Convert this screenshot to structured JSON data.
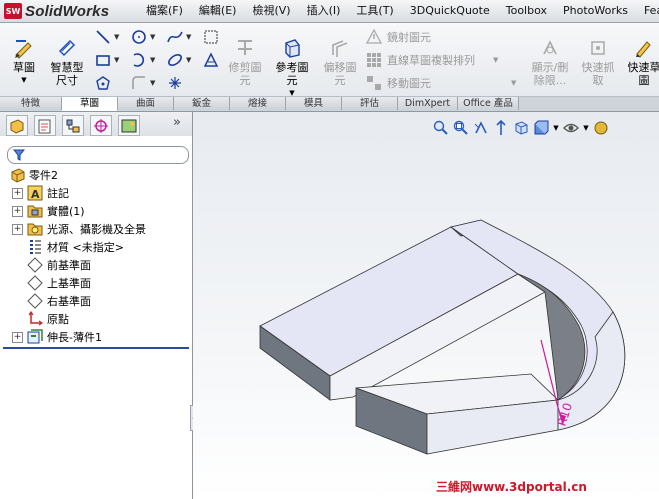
{
  "app": {
    "logo_badge": "SW",
    "name": "SolidWorks"
  },
  "menu": [
    "檔案(F)",
    "編輯(E)",
    "檢視(V)",
    "插入(I)",
    "工具(T)",
    "3DQuickQuote",
    "Toolbox",
    "PhotoWorks",
    "Featur"
  ],
  "ribbon": {
    "sketch": "草圖",
    "smart_dimension": [
      "智慧型",
      "尺寸"
    ],
    "trim": [
      "修剪圖",
      "元"
    ],
    "convert": [
      "參考圖",
      "元"
    ],
    "offset": [
      "偏移圖",
      "元"
    ],
    "mirror": "鏡射圖元",
    "linear_pattern": "直線草圖複製排列",
    "move": "移動圖元",
    "display_delete": [
      "顯示/刪",
      "除限..."
    ],
    "quick_snaps": [
      "快速抓",
      "取"
    ],
    "rapid_sketch": [
      "快速草",
      "圖"
    ]
  },
  "tabs": [
    "特徵",
    "草圖",
    "曲面",
    "鈑金",
    "熔接",
    "模具",
    "評估",
    "DimXpert",
    "Office 產品"
  ],
  "active_tab": "草圖",
  "tree": {
    "root": "零件2",
    "items": [
      "註記",
      "實體(1)",
      "光源、攝影機及全景",
      "材質 <未指定>",
      "前基準面",
      "上基準面",
      "右基準面",
      "原點",
      "伸長-薄件1"
    ]
  },
  "dimension_label": "R10",
  "watermark": "三維网www.3dportal.cn",
  "colors": {
    "accent": "#d1162a",
    "dimension": "#d11aa0",
    "part_face": "#e4e6f5",
    "part_side": "#6f7680"
  }
}
